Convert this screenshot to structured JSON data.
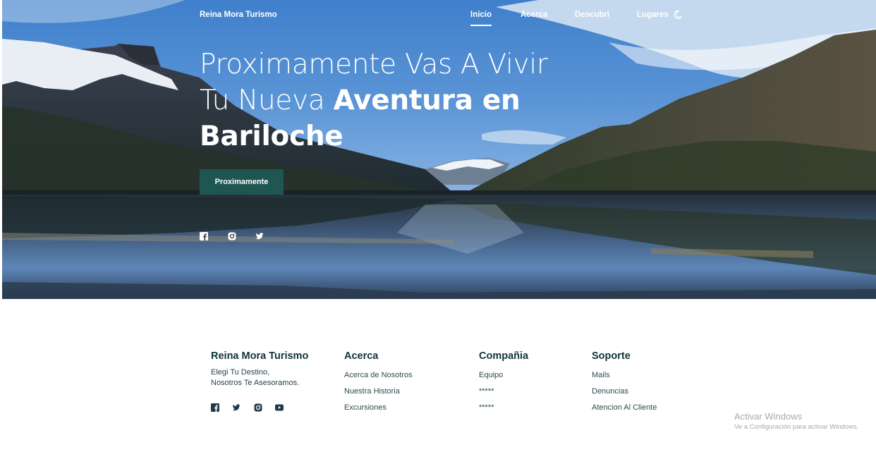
{
  "nav": {
    "brand": "Reina Mora Turismo",
    "links": [
      {
        "label": "Inicio",
        "active": true
      },
      {
        "label": "Acerca",
        "active": false
      },
      {
        "label": "Descubri",
        "active": false
      },
      {
        "label": "Lugares",
        "active": false
      }
    ],
    "theme_toggle_icon": "moon-icon"
  },
  "hero": {
    "title_line1": "Proximamente Vas A Vivir",
    "title_line2_light": "Tu Nueva",
    "title_line2_bold": "Aventura en",
    "title_line3_bold": "Bariloche",
    "cta_label": "Proximamente",
    "social_icons": [
      "facebook-icon",
      "instagram-icon",
      "twitter-icon"
    ]
  },
  "footer": {
    "brand": {
      "title": "Reina Mora Turismo",
      "line1": "Elegi Tu Destino,",
      "line2": "Nosotros Te Asesoramos.",
      "social_icons": [
        "facebook-icon",
        "twitter-icon",
        "instagram-icon",
        "youtube-icon"
      ]
    },
    "columns": [
      {
        "title": "Acerca",
        "items": [
          "Acerca de Nosotros",
          "Nuestra Historia",
          "Excursiones"
        ]
      },
      {
        "title": "Compañia",
        "items": [
          "Equipo",
          "*****",
          "*****"
        ]
      },
      {
        "title": "Soporte",
        "items": [
          "Mails",
          "Denuncias",
          "Atencion Al Cliente"
        ]
      }
    ]
  },
  "watermark": {
    "line1": "Activar Windows",
    "line2": "Ve a Configuración para activar Windows."
  },
  "colors": {
    "accent": "#1f5652",
    "footer_text": "#10333b",
    "sky": "#4e89cf"
  }
}
